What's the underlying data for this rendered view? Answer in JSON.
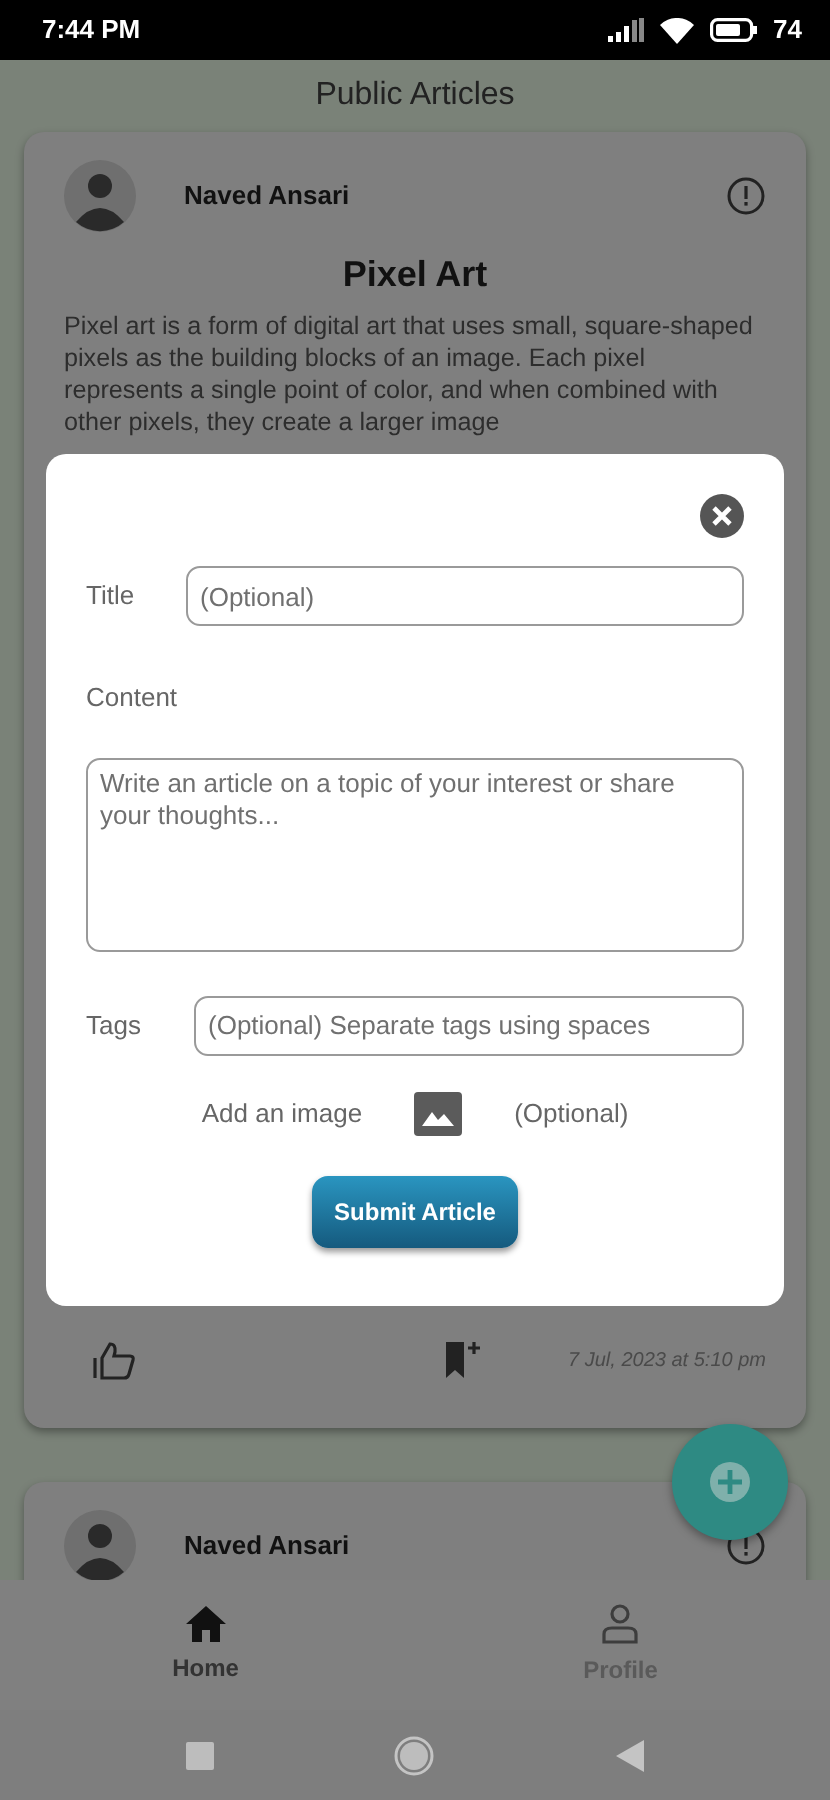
{
  "status_bar": {
    "time": "7:44 PM",
    "battery": "74"
  },
  "app_bar": {
    "title": "Public Articles"
  },
  "articles": [
    {
      "author": "Naved Ansari",
      "title": "Pixel Art",
      "body": "Pixel art is a form of digital art that uses small, square-shaped pixels as the building blocks of an image. Each pixel represents a single point of color, and when combined with other pixels, they create a larger image",
      "date": "7 Jul, 2023 at 5:10 pm"
    },
    {
      "author": "Naved Ansari"
    }
  ],
  "dialog": {
    "fields": [
      {
        "kind": "input",
        "label": "Title",
        "placeholder": "(Optional)"
      },
      {
        "kind": "textarea",
        "label": "Content",
        "placeholder": "Write an article on a topic of your interest or share your thoughts..."
      },
      {
        "kind": "input",
        "label": "Tags",
        "placeholder": "(Optional) Separate tags using spaces"
      }
    ],
    "image": {
      "label": "Add an image",
      "hint": "(Optional)"
    },
    "submit": "Submit Article"
  },
  "bottom_nav": [
    {
      "label": "Home",
      "selected": true
    },
    {
      "label": "Profile",
      "selected": false
    }
  ]
}
